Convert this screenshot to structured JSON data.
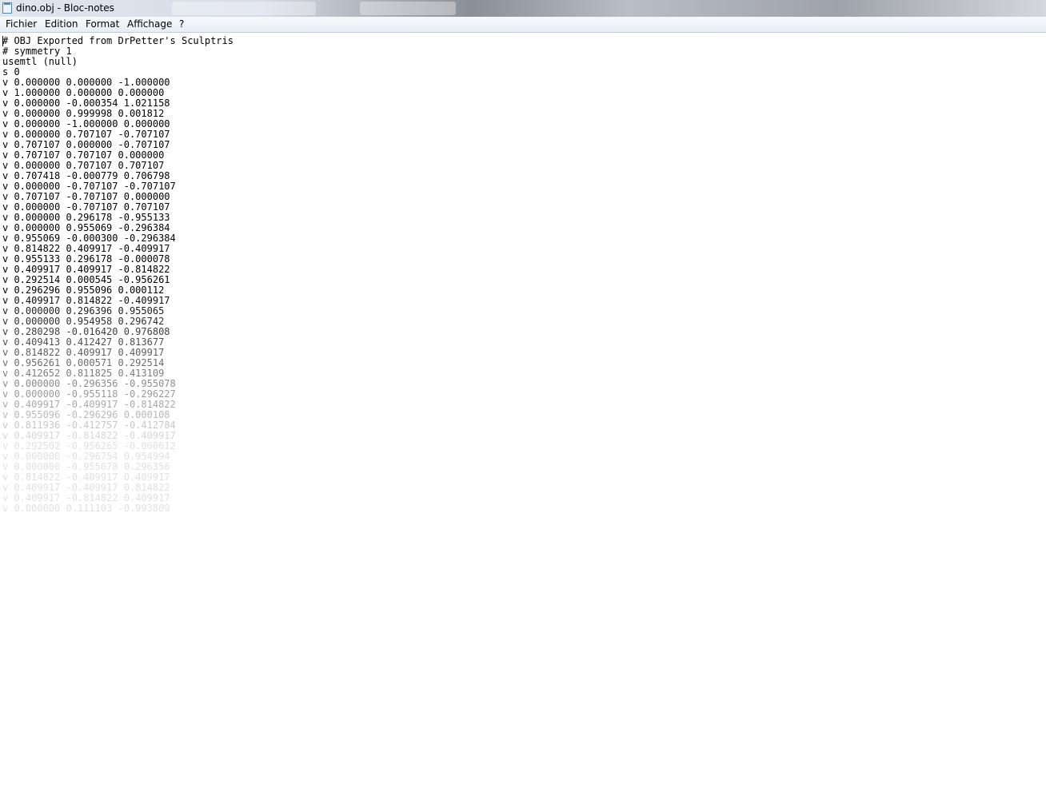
{
  "window": {
    "title": "dino.obj - Bloc-notes"
  },
  "menu": [
    "Fichier",
    "Edition",
    "Format",
    "Affichage",
    "?"
  ],
  "document": {
    "lines": [
      "# OBJ Exported from DrPetter's Sculptris",
      "# symmetry 1",
      "usemtl (null)",
      "s 0",
      "v 0.000000 0.000000 -1.000000",
      "v 1.000000 0.000000 0.000000",
      "v 0.000000 -0.000354 1.021158",
      "v 0.000000 0.999998 0.001812",
      "v 0.000000 -1.000000 0.000000",
      "v 0.000000 0.707107 -0.707107",
      "v 0.707107 0.000000 -0.707107",
      "v 0.707107 0.707107 0.000000",
      "v 0.000000 0.707107 0.707107",
      "v 0.707418 -0.000779 0.706798",
      "v 0.000000 -0.707107 -0.707107",
      "v 0.707107 -0.707107 0.000000",
      "v 0.000000 -0.707107 0.707107",
      "v 0.000000 0.296178 -0.955133",
      "v 0.000000 0.955069 -0.296384",
      "v 0.955069 -0.000300 -0.296384",
      "v 0.814822 0.409917 -0.409917",
      "v 0.955133 0.296178 -0.000078",
      "v 0.409917 0.409917 -0.814822",
      "v 0.292514 0.000545 -0.956261",
      "v 0.296296 0.955096 0.000112",
      "v 0.409917 0.814822 -0.409917",
      "v 0.000000 0.296396 0.955065",
      "v 0.000000 0.954958 0.296742",
      "v 0.280298 -0.016420 0.976808",
      "v 0.409413 0.412427 0.813677",
      "v 0.814822 0.409917 0.409917",
      "v 0.956261 0.000571 0.292514",
      "v 0.412652 0.811825 0.413109",
      "v 0.000000 -0.296356 -0.955078",
      "v 0.000000 -0.955118 -0.296227",
      "v 0.409917 -0.409917 -0.814822",
      "v 0.955096 -0.296296 0.000108",
      "v 0.811936 -0.412757 -0.412784",
      "v 0.409917 -0.814822 -0.409917",
      "v 0.292502 -0.956265 -0.000612",
      "v 0.000000 -0.296754 0.954994",
      "v 0.000000 -0.955078 0.296356",
      "v 0.814822 -0.409917 0.409917",
      "v 0.409917 -0.409917 0.814822",
      "v 0.409917 -0.814822 0.409917",
      "v 0.000000 0.111103 -0.993809"
    ]
  }
}
